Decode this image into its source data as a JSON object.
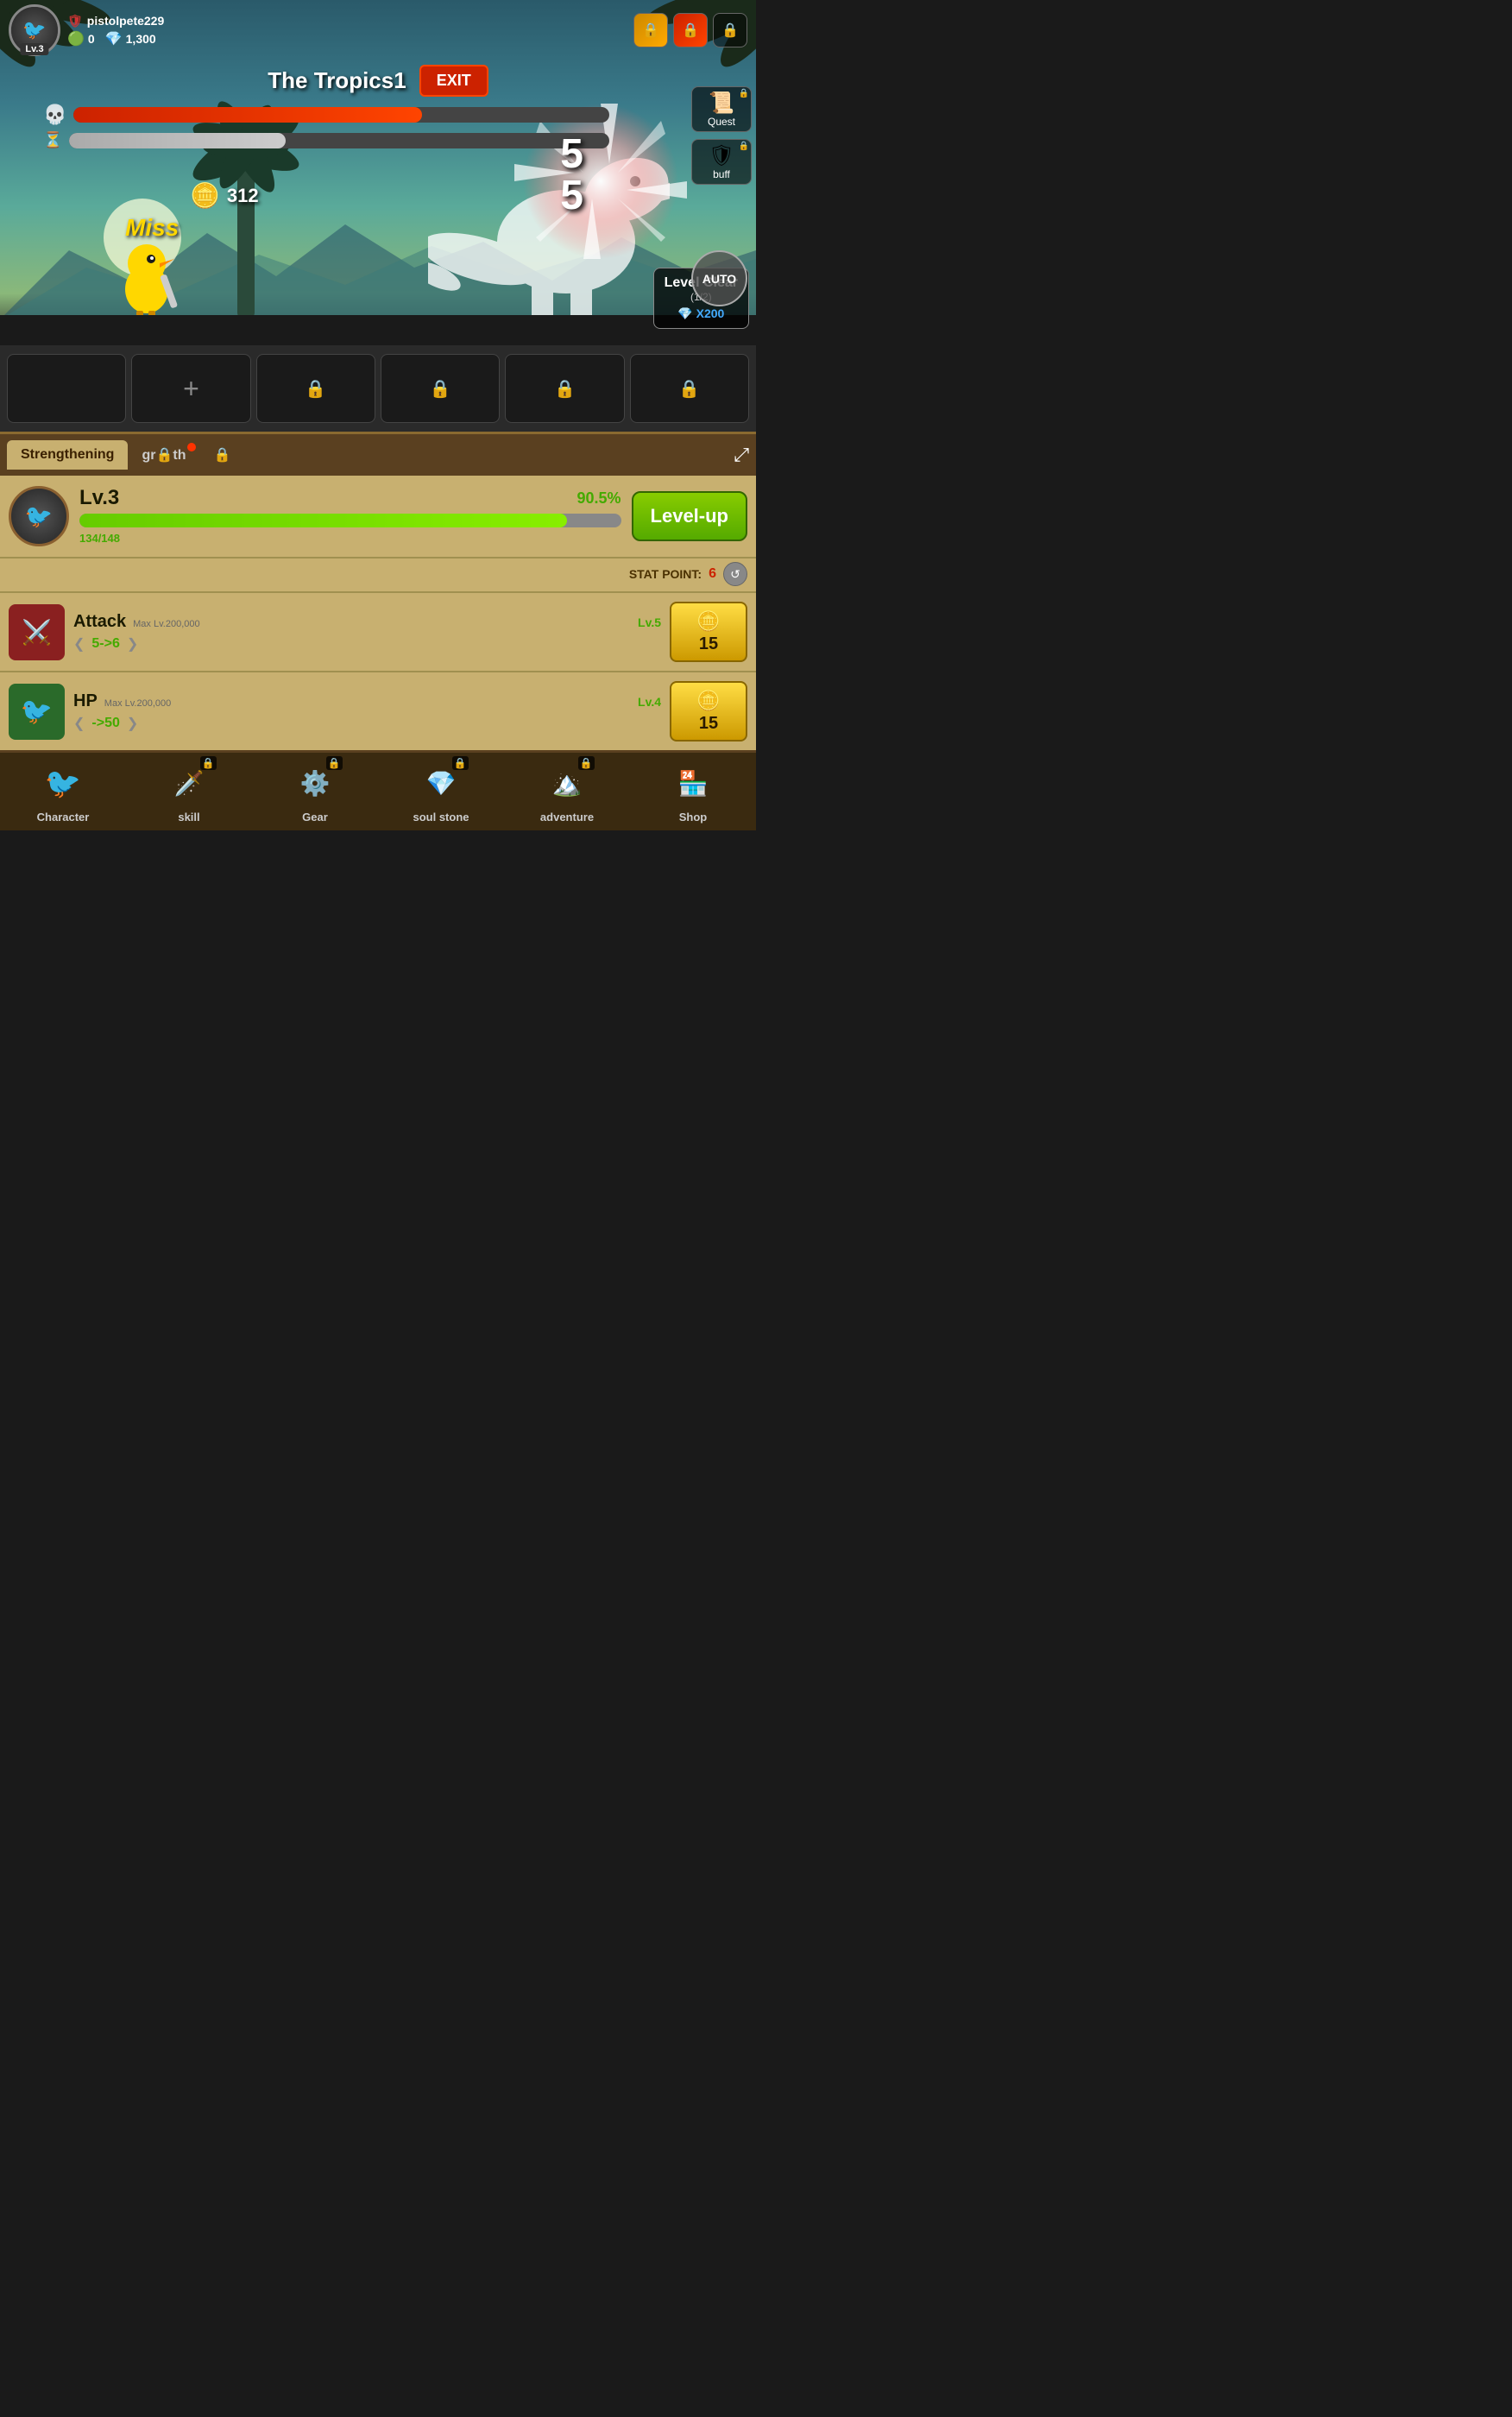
{
  "header": {
    "username": "pistolpete229",
    "level": "Lv.3",
    "gems": "0",
    "diamonds": "1,300",
    "locks": [
      "🔒",
      "🔒",
      "🔒"
    ]
  },
  "battle": {
    "level_name": "The Tropics1",
    "exit_label": "EXIT",
    "enemy_hp_pct": 65,
    "enemy_timer_pct": 40,
    "combo": "5",
    "combo2": "5",
    "coins": "312",
    "miss_text": "Miss"
  },
  "right_panel": {
    "quest_label": "Quest",
    "buff_label": "buff"
  },
  "level_clear": {
    "title": "Level Clear",
    "progress": "(1/2)",
    "reward": "X200"
  },
  "auto_btn": "AUTO",
  "skill_slots": {
    "add_label": "+",
    "slots": [
      "add",
      "lock",
      "lock",
      "lock",
      "lock",
      "lock"
    ]
  },
  "tabs": {
    "strengthening": "Strengthening",
    "growth": "gr🔒th",
    "locked": "🔒",
    "expand": "⤢"
  },
  "character": {
    "level_text": "Lv.3",
    "xp_pct": "90.5%",
    "xp_current": "134",
    "xp_max": "148",
    "xp_display": "134/148",
    "xp_fill_pct": 90,
    "level_up_label": "Level-up"
  },
  "stat_point": {
    "label": "STAT POINT:",
    "value": "6",
    "reset_icon": "↺"
  },
  "attack": {
    "name": "Attack",
    "max_lv": "Max Lv.200,000",
    "current_lv": "Lv.5",
    "level_change": "5->6",
    "cost": "15"
  },
  "hp": {
    "name": "HP",
    "max_lv": "Max Lv.200,000",
    "current_lv": "Lv.4",
    "level_change": "->50",
    "cost": "15"
  },
  "nav": {
    "items": [
      {
        "label": "Character",
        "icon": "👤",
        "locked": false
      },
      {
        "label": "skill",
        "icon": "⚔️",
        "locked": true
      },
      {
        "label": "Gear",
        "icon": "⚙️",
        "locked": true
      },
      {
        "label": "soul stone",
        "icon": "💎",
        "locked": true
      },
      {
        "label": "adventure",
        "icon": "🏔️",
        "locked": true
      },
      {
        "label": "Shop",
        "icon": "🏪",
        "locked": false
      }
    ]
  }
}
